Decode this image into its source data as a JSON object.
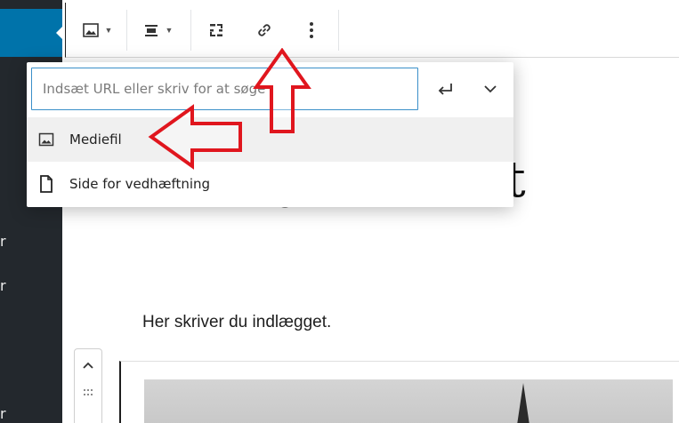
{
  "sidebar": {
    "stubs": [
      "r",
      "r",
      "r"
    ]
  },
  "toolbar": {
    "buttons": [
      {
        "name": "image-button",
        "icon": "image-icon",
        "has_caret": true
      },
      {
        "name": "align-button",
        "icon": "align-center-icon",
        "has_caret": true
      },
      {
        "name": "replace-button",
        "icon": "replace-icon",
        "has_caret": false
      },
      {
        "name": "link-button",
        "icon": "link-icon",
        "has_caret": false
      },
      {
        "name": "more-options-button",
        "icon": "more-vertical-icon",
        "has_caret": false
      }
    ]
  },
  "popover": {
    "url_input": {
      "value": "",
      "placeholder": "Indsæt URL eller skriv for at søge"
    },
    "submit_icon": "enter-icon",
    "toggle_icon": "chevron-down-icon",
    "suggestions": [
      {
        "label": "Mediefil",
        "icon": "image-icon",
        "selected": true
      },
      {
        "label": "Side for vedhæftning",
        "icon": "page-icon",
        "selected": false
      }
    ]
  },
  "content": {
    "heading_fragment_left": ",j",
    "heading_fragment_right": "rift",
    "paragraph": "Her skriver du indlægget."
  },
  "annotations": {
    "arrow_color": "#e0161e",
    "arrows": [
      "arrow-up-to-link-button",
      "arrow-left-to-mediefil"
    ]
  },
  "colors": {
    "sidebar_bg": "#23282d",
    "sidebar_active": "#0073aa",
    "input_focus": "#3a8fc9"
  }
}
